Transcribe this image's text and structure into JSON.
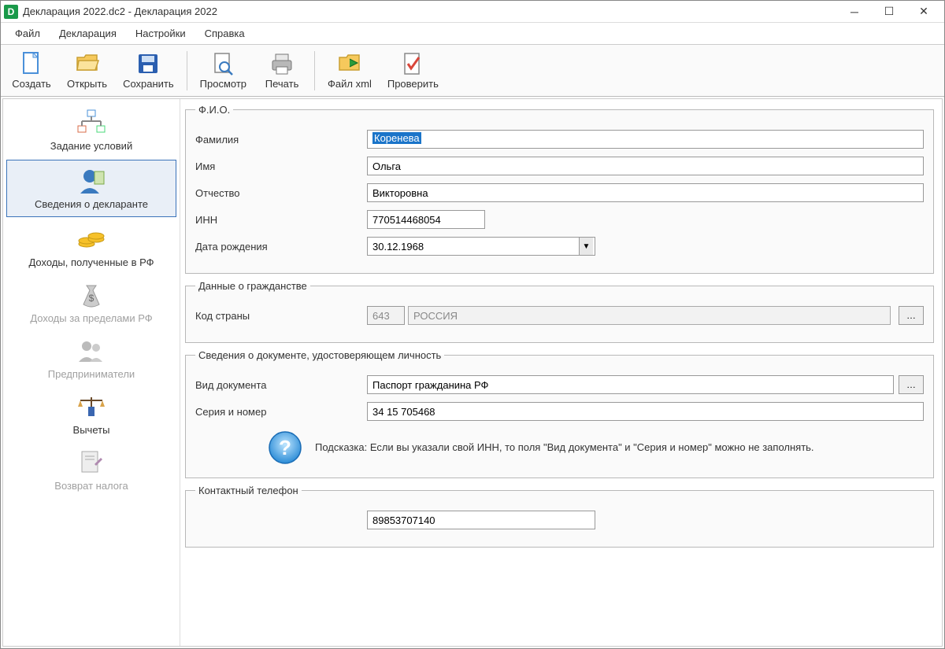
{
  "window": {
    "title": "Декларация 2022.dc2 - Декларация 2022"
  },
  "menu": {
    "file": "Файл",
    "declaration": "Декларация",
    "settings": "Настройки",
    "help": "Справка"
  },
  "toolbar": {
    "create": "Создать",
    "open": "Открыть",
    "save": "Сохранить",
    "preview": "Просмотр",
    "print": "Печать",
    "file_xml": "Файл xml",
    "check": "Проверить"
  },
  "sidebar": {
    "conditions": "Задание условий",
    "declarant": "Сведения о декларанте",
    "income_rf": "Доходы, полученные в РФ",
    "income_foreign": "Доходы за пределами РФ",
    "entrepreneurs": "Предприниматели",
    "deductions": "Вычеты",
    "tax_return": "Возврат налога"
  },
  "fio": {
    "legend": "Ф.И.О.",
    "surname_label": "Фамилия",
    "surname": "Коренева",
    "name_label": "Имя",
    "name": "Ольга",
    "patronymic_label": "Отчество",
    "patronymic": "Викторовна",
    "inn_label": "ИНН",
    "inn": "770514468054",
    "dob_label": "Дата рождения",
    "dob": "30.12.1968"
  },
  "citizenship": {
    "legend": "Данные о гражданстве",
    "country_code_label": "Код страны",
    "country_code": "643",
    "country_name": "РОССИЯ"
  },
  "document": {
    "legend": "Сведения о документе, удостоверяющем личность",
    "type_label": "Вид документа",
    "type": "Паспорт гражданина РФ",
    "series_label": "Серия и номер",
    "series": "34 15 705468",
    "hint": "Подсказка: Если вы указали свой ИНН, то поля \"Вид документа\" и \"Серия и номер\" можно не заполнять."
  },
  "contact": {
    "legend": "Контактный телефон",
    "phone": "89853707140"
  }
}
